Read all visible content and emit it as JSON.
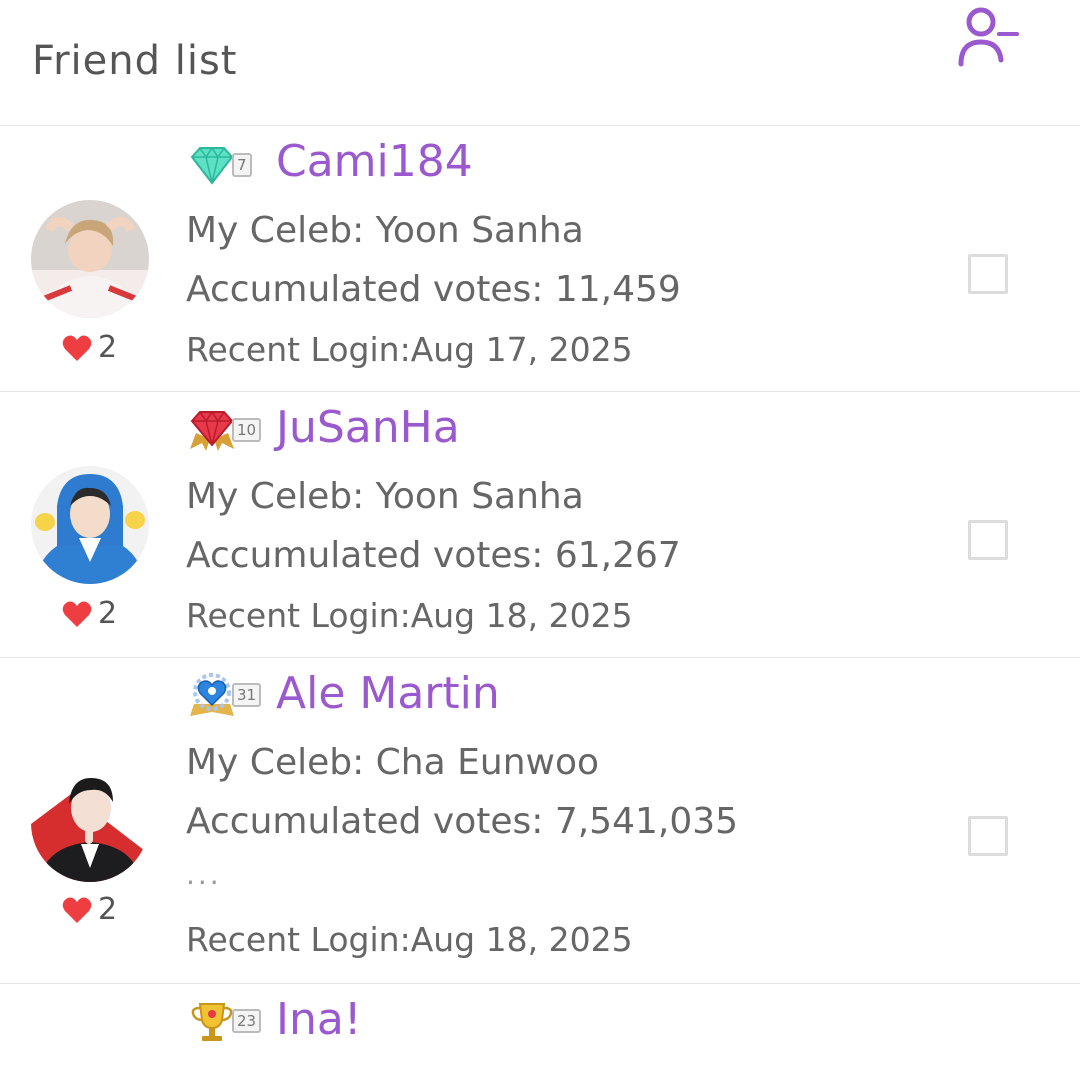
{
  "header": {
    "title": "Friend list",
    "action_icon": "remove-friend-icon",
    "accent": "#9b59d0"
  },
  "labels": {
    "celeb_prefix": "My Celeb: ",
    "votes_prefix": "Accumulated votes: ",
    "login_prefix": "Recent Login:"
  },
  "friends": [
    {
      "nickname": "Cami184",
      "level": "7",
      "badge_icon": "teal-diamond-icon",
      "celeb": "Yoon Sanha",
      "votes": "11,459",
      "recent_login": "Aug 17, 2025",
      "likes": "2",
      "more": ""
    },
    {
      "nickname": "JuSanHa",
      "level": "10",
      "badge_icon": "red-gem-icon",
      "celeb": "Yoon Sanha",
      "votes": "61,267",
      "recent_login": "Aug 18, 2025",
      "likes": "2",
      "more": ""
    },
    {
      "nickname": "Ale Martin",
      "level": "31",
      "badge_icon": "blue-heart-crest-icon",
      "celeb": "Cha Eunwoo",
      "votes": "7,541,035",
      "recent_login": "Aug 18, 2025",
      "likes": "2",
      "more": "..."
    },
    {
      "nickname": "Ina!",
      "level": "23",
      "badge_icon": "gold-trophy-icon",
      "celeb": "",
      "votes": "",
      "recent_login": "",
      "likes": "",
      "more": ""
    }
  ]
}
